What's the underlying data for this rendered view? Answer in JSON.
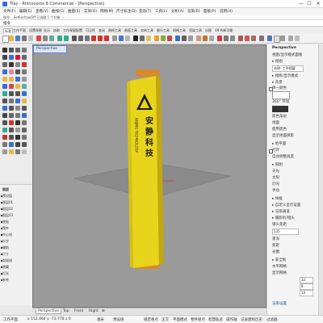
{
  "window": {
    "title": "Tray - Rhinoceros 8 Commercial - [Perspective]",
    "minimize": "—",
    "maximize": "☐",
    "close": "✕"
  },
  "menu": [
    "文件(F)",
    "编辑(E)",
    "查看(V)",
    "曲线(C)",
    "曲面(S)",
    "实体(O)",
    "网格(M)",
    "尺寸标注(D)",
    "变动(T)",
    "工具(L)",
    "分析(A)",
    "渲染(R)",
    "面板(P)",
    "说明(H)"
  ],
  "command": {
    "history": "指令: _SetRedrawOff 已选取 1 个对象 ...",
    "prompt": "指令"
  },
  "toolbar_tabs": [
    "标准",
    "工作平面",
    "设置视图",
    "显示",
    "选取",
    "工作视窗配置",
    "可见性",
    "变动",
    "曲线工具",
    "曲面工具",
    "实体工具",
    "细分工具",
    "网格工具",
    "渲染工具",
    "出图",
    "V8 的新功能"
  ],
  "layers": [
    "图层",
    "预设值",
    "图层01",
    "图层02",
    "图层03",
    "底板",
    "零件",
    "中心线",
    "文字",
    "辅助",
    "尺寸",
    "剖面线",
    "隐藏",
    "灯光",
    "参考"
  ],
  "viewport": {
    "tab_label": "Perspective",
    "object_text_cn": "安 静 科 技",
    "object_text_en": "ANJING TECHNOLOGY"
  },
  "bottom_tabs": [
    "Perspective",
    "Top",
    "Front",
    "Right",
    "⊕"
  ],
  "status": {
    "plane": "工作平面",
    "coords": "x 152.464   y -73.778   z 0",
    "unit": "毫米",
    "layer": "预设值",
    "grid_snap": "锁定格点",
    "ortho": "正交",
    "planar": "平面模式",
    "osnap": "物件锁点",
    "smart_track": "智慧轨迹",
    "gumball": "操作轴",
    "history": "记录建构历史",
    "filter": "过滤器"
  },
  "right_panel": {
    "title": "Perspective",
    "items": [
      "视图/显示模式面板",
      "▸ 视图",
      "  名称: 工作视窗",
      "▸ 相机/显示模式",
      "▸ 背景",
      "  单一颜色",
      "  360° 环境",
      "  底色渐层",
      "  地面",
      "  使用底色",
      "  显示地面阴影",
      "▸ 地平面",
      "  打开",
      "  自动调整高度",
      "▸ 照明",
      "  天光",
      "  太阳",
      "  灯光",
      "  手动",
      "▸ 线框",
      "▸ 自定义显示设置",
      "▸ 渲染通道",
      "▸ 摄影机/镜头",
      "  镜头焦距",
      "  135",
      "  景深",
      "  焦距",
      "  光圈",
      "▸ 安全框",
      "  水平网格",
      "  显示网格",
      "  32",
      "  8",
      "  14"
    ],
    "bottom_button": "渲染设置"
  },
  "colors": {
    "object_yellow": "#e8d41a",
    "object_shadow": "#c4a60e",
    "object_orange_cap": "#d98a2b",
    "viewport_bg": "#9a9a9a",
    "active_tab": "#dbe6f5"
  }
}
